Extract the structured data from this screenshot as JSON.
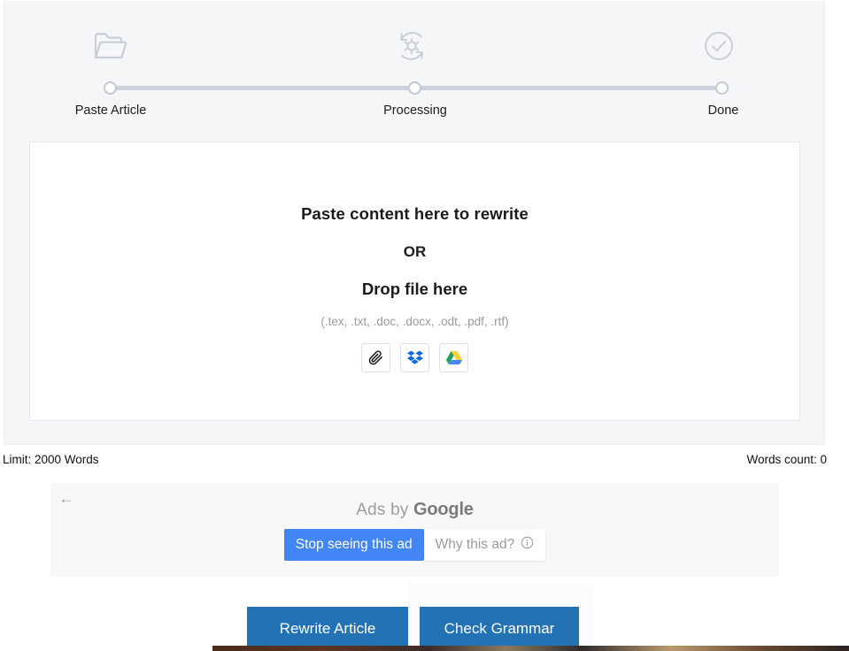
{
  "stepper": {
    "steps": [
      {
        "label": "Paste Article",
        "icon": "folder-open-icon",
        "state": "active"
      },
      {
        "label": "Processing",
        "icon": "gear-sync-icon",
        "state": "inactive"
      },
      {
        "label": "Done",
        "icon": "check-circle-icon",
        "state": "inactive"
      }
    ]
  },
  "dropzone": {
    "title": "Paste content here to rewrite",
    "or": "OR",
    "drop": "Drop file here",
    "formats": "(.tex, .txt, .doc, .docx, .odt, .pdf, .rtf)",
    "upload_buttons": [
      {
        "name": "paperclip-icon",
        "title": "Attach file"
      },
      {
        "name": "dropbox-icon",
        "title": "Dropbox"
      },
      {
        "name": "google-drive-icon",
        "title": "Google Drive"
      }
    ]
  },
  "status": {
    "limit": "Limit: 2000 Words",
    "words_count": "Words count: 0"
  },
  "ad": {
    "back_arrow": "←",
    "byline_prefix": "Ads by",
    "byline_brand": "Google",
    "stop_label": "Stop seeing this ad",
    "why_label": "Why this ad?"
  },
  "actions": {
    "rewrite_label": "Rewrite Article",
    "grammar_label": "Check Grammar"
  },
  "colors": {
    "panel_bg": "#f5f6f8",
    "stepper_gray": "#c9cedb",
    "google_blue": "#4285f4",
    "action_blue": "#2272b4",
    "dropbox_blue": "#0061fe",
    "drive_green": "#1da462",
    "drive_yellow": "#ffcf33",
    "drive_blue": "#4688f1"
  }
}
